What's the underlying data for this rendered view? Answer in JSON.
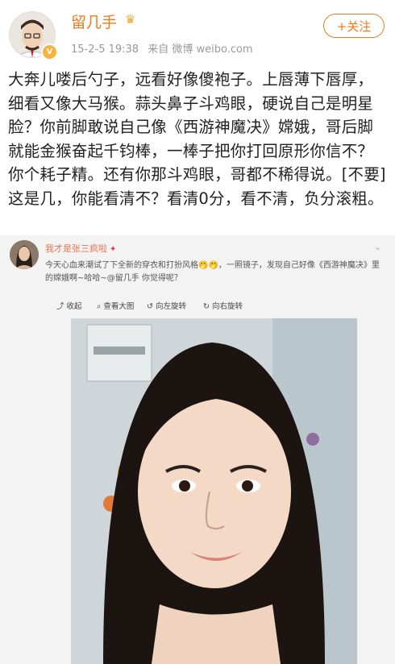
{
  "post": {
    "username": "留几手",
    "time": "15-2-5 19:38",
    "source": "来自 微博 weibo.com",
    "follow_label": "+关注",
    "text": "大奔儿喽后勺子，远看好像傻袍子。上唇薄下唇厚，细看又像大马猴。蒜头鼻子斗鸡眼，硬说自己是明星脸？你前脚敢说自己像《西游神魔决》嫦娥，哥后脚就能金猴奋起千钧棒，一棒子把你打回原形你信不？你个耗子精。还有你那斗鸡眼，哥都不稀得说。[不要]这是几，你能看清不？看清0分，看不清，负分滚粗。"
  },
  "quoted": {
    "username": "我才是张三疯啦",
    "text": "今天心血来潮试了下全新的穿衣和打扮风格🤭🤭，一照镜子，发现自己好像《西游神魔决》里的嫦娥啊~哈哈~@留几手 你觉得呢？",
    "toolbar": [
      "收起",
      "查看大图",
      "向左旋转",
      "向右旋转"
    ]
  },
  "icons": {
    "crown": "crown-icon",
    "verified": "verified-badge-icon",
    "chevron": "chevron-down-icon"
  },
  "colors": {
    "accent": "#f07a1c",
    "quote_bg": "#f3f3f3"
  }
}
